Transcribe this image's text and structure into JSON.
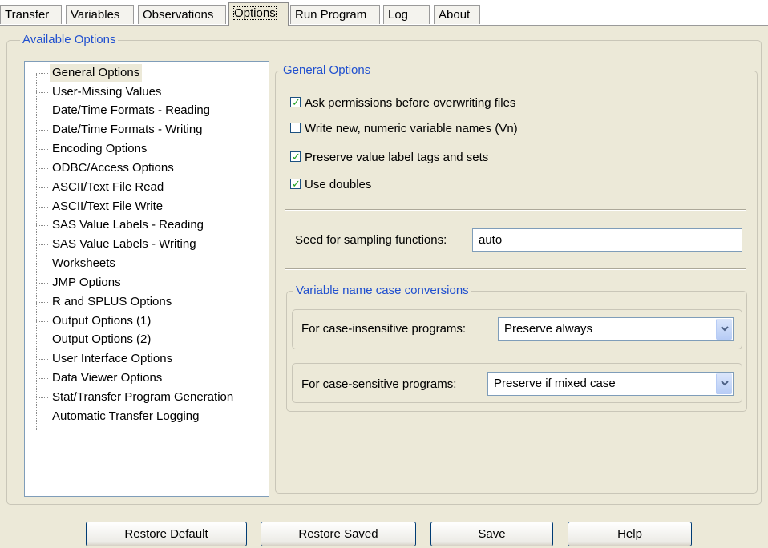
{
  "tabs": [
    "Transfer",
    "Variables",
    "Observations",
    "Options",
    "Run Program",
    "Log",
    "About"
  ],
  "active_tab": "Options",
  "available_options": {
    "label": "Available Options",
    "items": [
      "General Options",
      "User-Missing Values",
      "Date/Time Formats - Reading",
      "Date/Time Formats - Writing",
      "Encoding Options",
      "ODBC/Access Options",
      "ASCII/Text File Read",
      "ASCII/Text File Write",
      "SAS Value Labels - Reading",
      "SAS Value Labels - Writing",
      "Worksheets",
      "JMP Options",
      "R and SPLUS Options",
      "Output Options (1)",
      "Output Options (2)",
      "User Interface Options",
      "Data Viewer Options",
      "Stat/Transfer Program Generation",
      "Automatic Transfer Logging"
    ],
    "selected": "General Options"
  },
  "general": {
    "label": "General Options",
    "checkboxes": [
      {
        "label": "Ask permissions before overwriting files",
        "checked": true
      },
      {
        "label": "Write new, numeric variable names (Vn)",
        "checked": false
      },
      {
        "label": "Preserve value label tags and sets",
        "checked": true
      },
      {
        "label": "Use doubles",
        "checked": true
      }
    ],
    "seed_label": "Seed for sampling functions:",
    "seed_value": "auto"
  },
  "case_conversions": {
    "label": "Variable name case conversions",
    "insensitive_label": "For case-insensitive programs:",
    "insensitive_value": "Preserve always",
    "sensitive_label": "For case-sensitive programs:",
    "sensitive_value": "Preserve if mixed case"
  },
  "buttons": {
    "restore_default": "Restore Default",
    "restore_saved": "Restore Saved",
    "save": "Save",
    "help": "Help"
  },
  "colors": {
    "panel": "#ece9d8",
    "group_label": "#1f4fcf",
    "checkmark": "#21a121"
  }
}
